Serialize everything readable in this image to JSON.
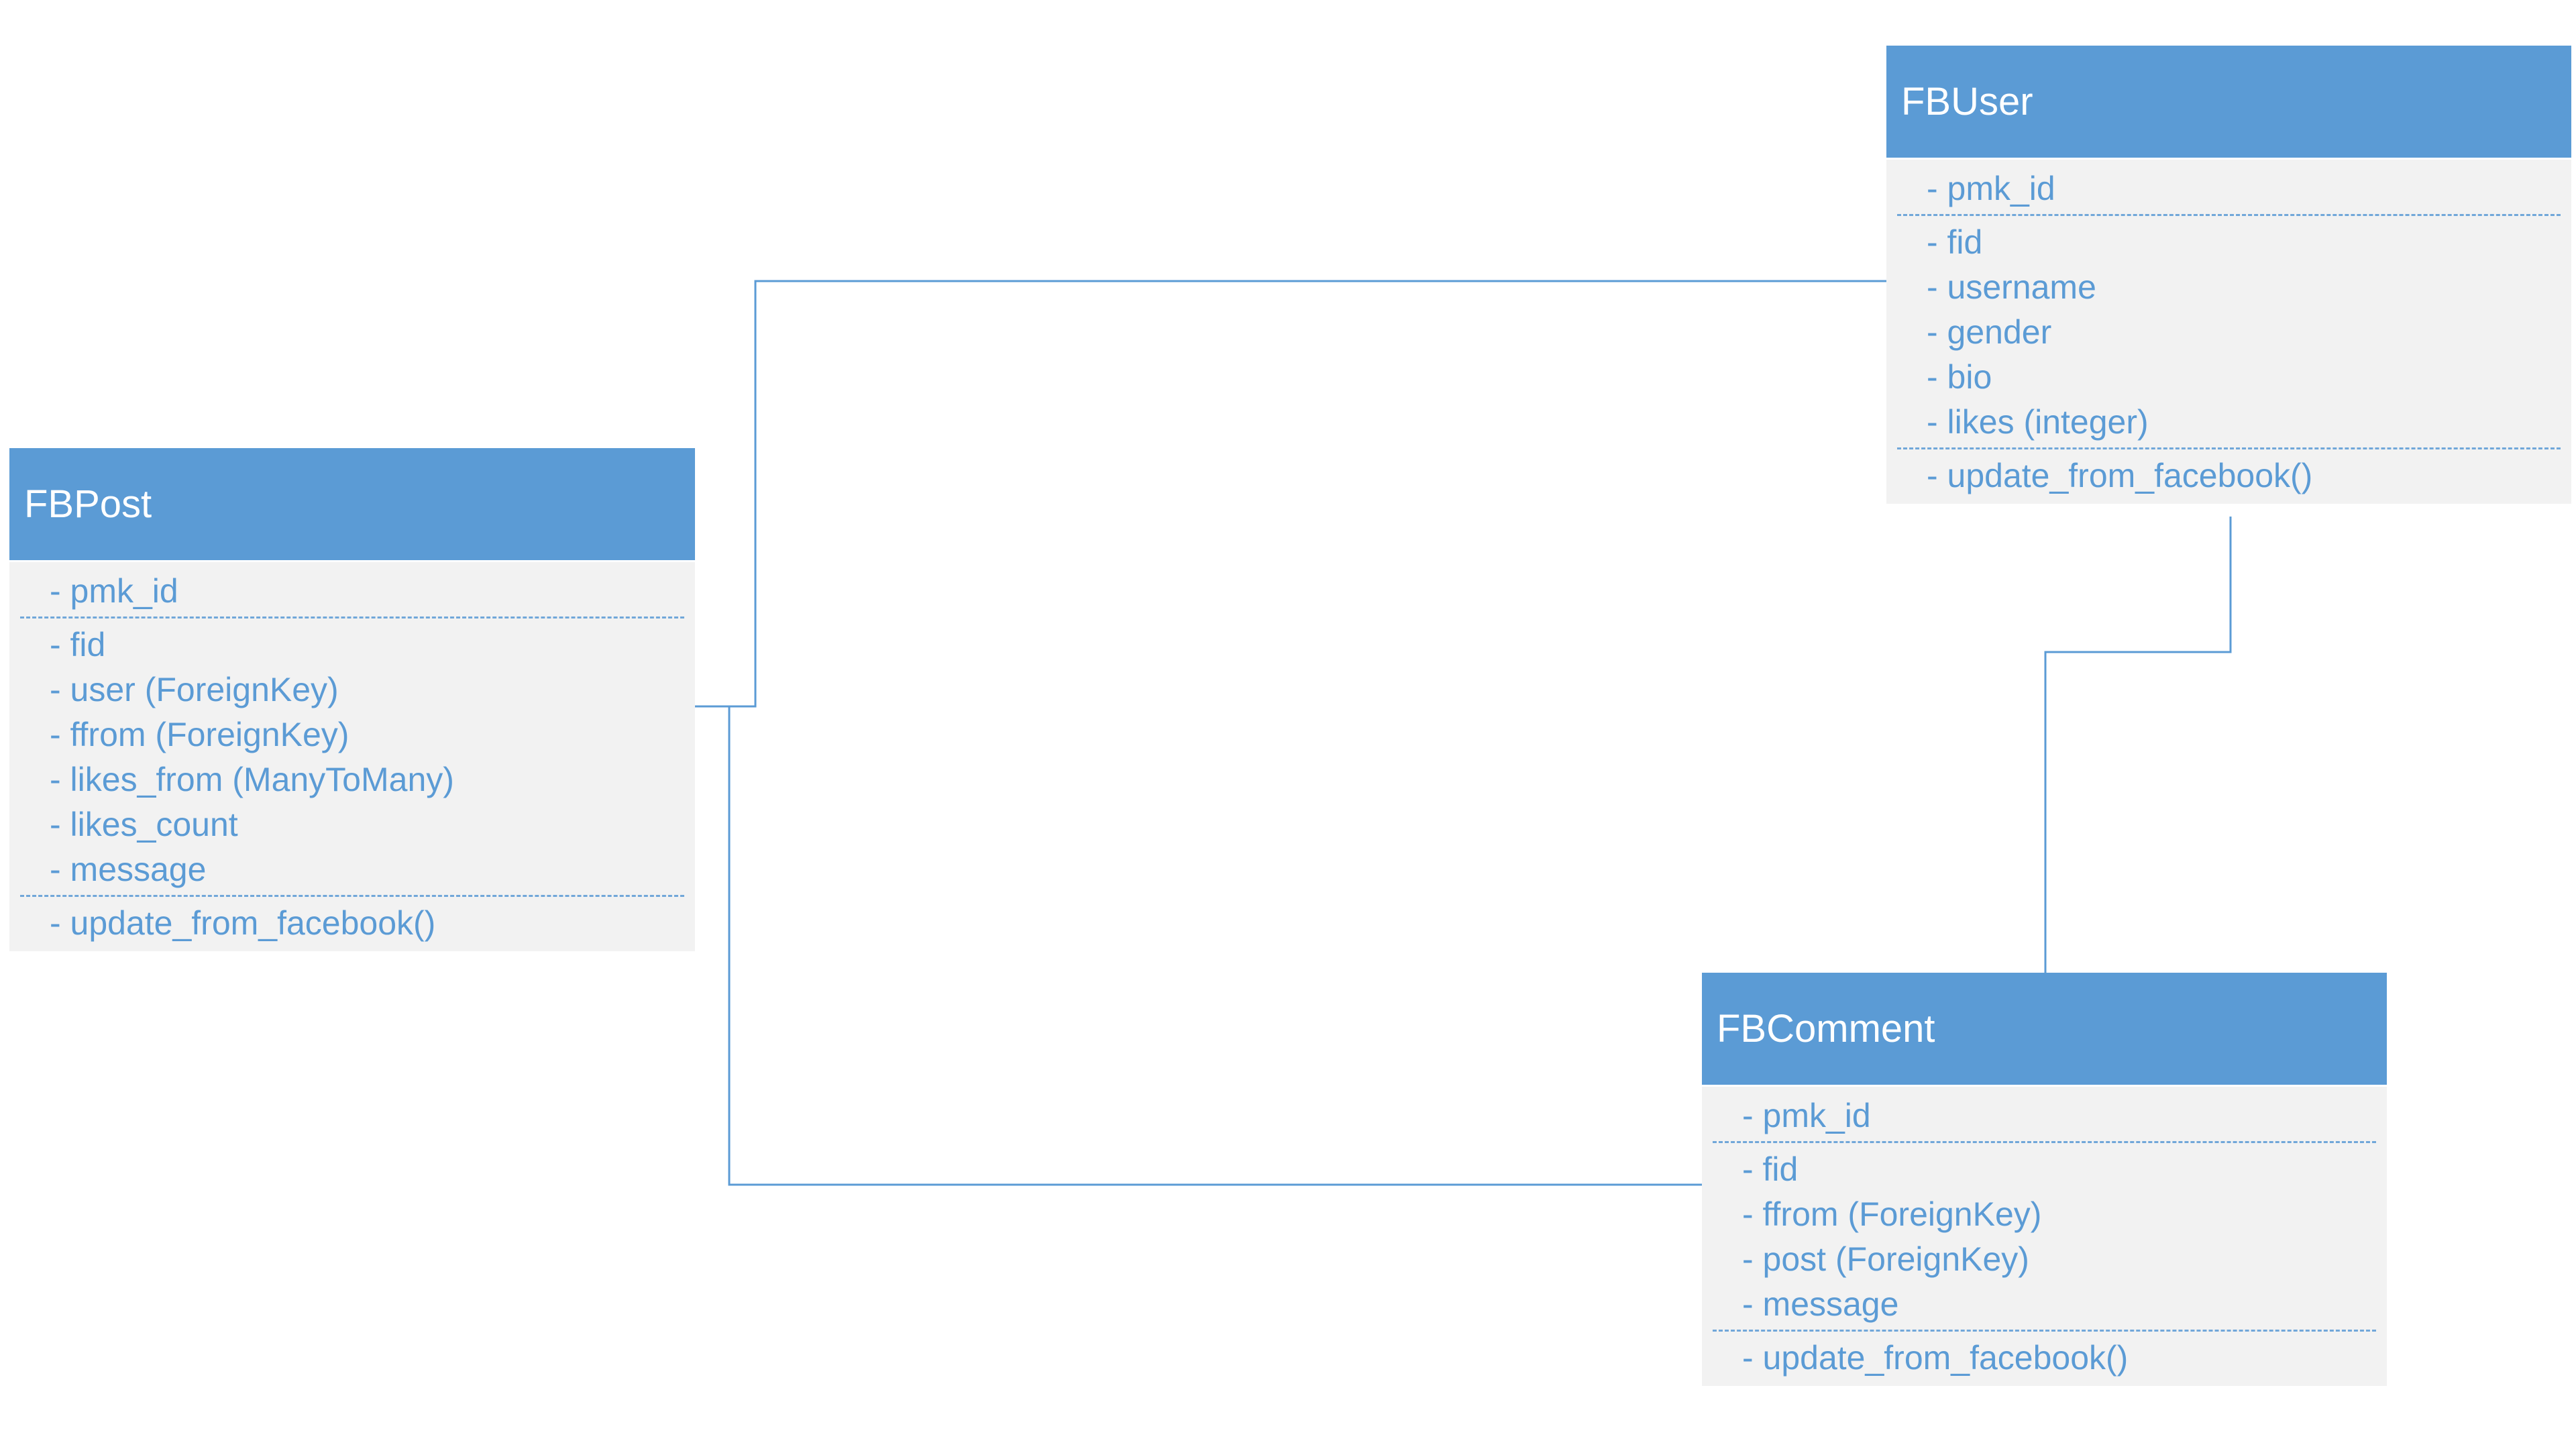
{
  "classes": {
    "fbpost": {
      "name": "FBPost",
      "primary": [
        "- pmk_id"
      ],
      "fields": [
        "- fid",
        "- user (ForeignKey)",
        "- ffrom (ForeignKey)",
        "- likes_from (ManyToMany)",
        "- likes_count",
        "- message"
      ],
      "methods": [
        "- update_from_facebook()"
      ]
    },
    "fbuser": {
      "name": "FBUser",
      "primary": [
        "- pmk_id"
      ],
      "fields": [
        "- fid",
        "- username",
        "- gender",
        "- bio",
        "- likes (integer)"
      ],
      "methods": [
        "- update_from_facebook()"
      ]
    },
    "fbcomment": {
      "name": "FBComment",
      "primary": [
        "- pmk_id"
      ],
      "fields": [
        "- fid",
        "- ffrom (ForeignKey)",
        "- post (ForeignKey)",
        "- message"
      ],
      "methods": [
        "- update_from_facebook()"
      ]
    }
  },
  "relations": [
    {
      "from": "FBPost",
      "to": "FBUser"
    },
    {
      "from": "FBPost",
      "to": "FBComment"
    },
    {
      "from": "FBUser",
      "to": "FBComment"
    }
  ],
  "colors": {
    "header": "#5b9bd5",
    "body": "#f2f2f2",
    "text": "#5b9bd5",
    "title": "#ffffff"
  }
}
